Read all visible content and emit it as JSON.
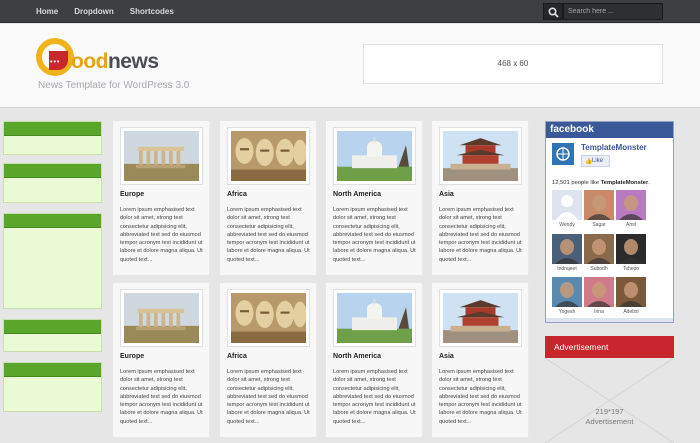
{
  "nav": {
    "items": [
      "Home",
      "Dropdown",
      "Shortcodes"
    ]
  },
  "search": {
    "placeholder": "Search here ..."
  },
  "header": {
    "logo_first": "G",
    "logo_mid": "ood",
    "logo_rest": "news",
    "tagline": "News Template for WordPress 3.0",
    "banner": "468 x 60"
  },
  "cards": [
    {
      "title": "Europe",
      "image": "parthenon-photo",
      "text": "Lorem ipsum emphasised text dolor sit amet, strong text consectetur adipisicing elit, abbreviated text sed do eiusmod tempor acronym text incididunt ut labore et dolore magna aliqua. Ut quoted text..."
    },
    {
      "title": "Africa",
      "image": "statues-photo",
      "text": "Lorem ipsum emphasised text dolor sit amet, strong text consectetur adipisicing elit, abbreviated text sed do eiusmod tempor acronym text incididunt ut labore et dolore magna aliqua. Ut quoted text..."
    },
    {
      "title": "North America",
      "image": "capitol-photo",
      "text": "Lorem ipsum emphasised text dolor sit amet, strong text consectetur adipisicing elit, abbreviated text sed do eiusmod tempor acronym text incididunt ut labore et dolore magna aliqua. Ut quoted text..."
    },
    {
      "title": "Asia",
      "image": "pagoda-photo",
      "text": "Lorem ipsum emphasised text dolor sit amet, strong text consectetur adipisicing elit, abbreviated text sed do eiusmod tempor acronym text incididunt ut labore et dolore magna aliqua. Ut quoted text..."
    },
    {
      "title": "Europe",
      "image": "parthenon-photo",
      "text": "Lorem ipsum emphasised text dolor sit amet, strong text consectetur adipisicing elit, abbreviated text sed do eiusmod tempor acronym text incididunt ut labore et dolore magna aliqua. Ut quoted text..."
    },
    {
      "title": "Africa",
      "image": "statues-photo",
      "text": "Lorem ipsum emphasised text dolor sit amet, strong text consectetur adipisicing elit, abbreviated text sed do eiusmod tempor acronym text incididunt ut labore et dolore magna aliqua. Ut quoted text..."
    },
    {
      "title": "North America",
      "image": "capitol-photo",
      "text": "Lorem ipsum emphasised text dolor sit amet, strong text consectetur adipisicing elit, abbreviated text sed do eiusmod tempor acronym text incididunt ut labore et dolore magna aliqua. Ut quoted text..."
    },
    {
      "title": "Asia",
      "image": "pagoda-photo",
      "text": "Lorem ipsum emphasised text dolor sit amet, strong text consectetur adipisicing elit, abbreviated text sed do eiusmod tempor acronym text incididunt ut labore et dolore magna aliqua. Ut quoted text..."
    }
  ],
  "facebook": {
    "header": "facebook",
    "page_name": "TemplateMonster",
    "like_label": "Like",
    "count_prefix": "12,501 people like ",
    "count_name": "TemplateMonster",
    "count_suffix": ".",
    "fans": [
      {
        "name": "Wendy",
        "color": "#dfe3ee"
      },
      {
        "name": "Sagar",
        "color": "#c98a6a"
      },
      {
        "name": "Amit",
        "color": "#b97ac0"
      },
      {
        "name": "Indrajeet",
        "color": "#4a5f7a"
      },
      {
        "name": "Subodh",
        "color": "#8a6a4a"
      },
      {
        "name": "Tshepo",
        "color": "#2b2b2b"
      },
      {
        "name": "Yogesh",
        "color": "#5a8ab0"
      },
      {
        "name": "Irina",
        "color": "#d07a8a"
      },
      {
        "name": "Adebsi",
        "color": "#7a5a3a"
      }
    ]
  },
  "advertisement": {
    "title": "Advertisement",
    "size": "219*197",
    "label": "Advertisement"
  },
  "colors": {
    "accent_green": "#5aa62a",
    "accent_red": "#c8262c",
    "facebook_blue": "#3b5998",
    "logo_gold": "#e4a417"
  }
}
